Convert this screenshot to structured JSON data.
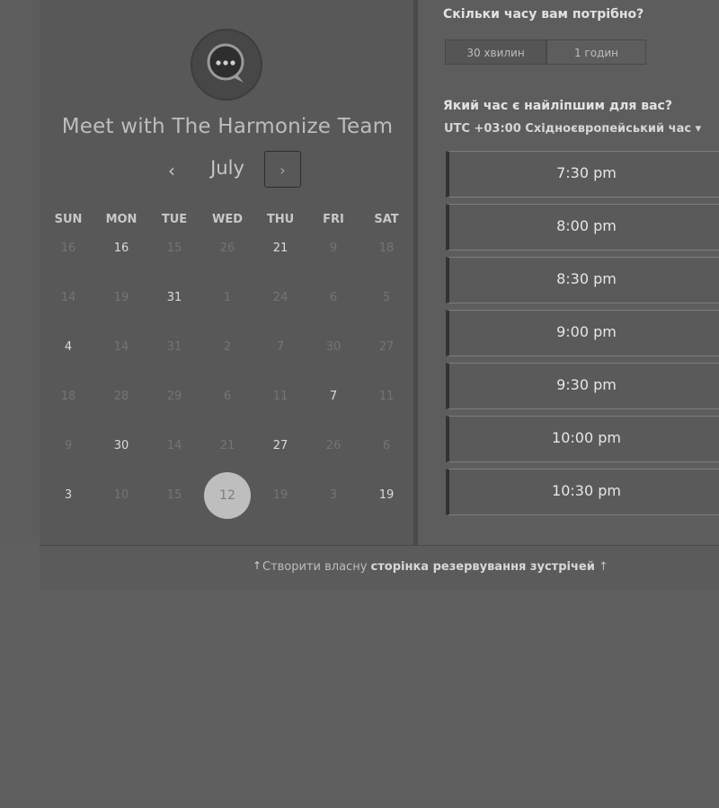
{
  "scheduler": {
    "title": "Meet with The Harmonize Team",
    "nav": {
      "prev_icon": "‹",
      "next_icon": "›",
      "month": "July"
    },
    "weekdays": [
      "SUN",
      "MON",
      "TUE",
      "WED",
      "THU",
      "FRI",
      "SAT"
    ],
    "weeks": [
      [
        {
          "d": "16",
          "s": "dim"
        },
        {
          "d": "16",
          "s": "on"
        },
        {
          "d": "15",
          "s": "dim"
        },
        {
          "d": "26",
          "s": "dim"
        },
        {
          "d": "21",
          "s": "on"
        },
        {
          "d": "9",
          "s": "dim"
        },
        {
          "d": "18",
          "s": "dim"
        }
      ],
      [
        {
          "d": "14",
          "s": "dim"
        },
        {
          "d": "19",
          "s": "dim"
        },
        {
          "d": "31",
          "s": "on"
        },
        {
          "d": "1",
          "s": "dim"
        },
        {
          "d": "24",
          "s": "dim"
        },
        {
          "d": "6",
          "s": "dim"
        },
        {
          "d": "5",
          "s": "dim"
        }
      ],
      [
        {
          "d": "4",
          "s": "on"
        },
        {
          "d": "14",
          "s": "dim"
        },
        {
          "d": "31",
          "s": "dim"
        },
        {
          "d": "2",
          "s": "dim"
        },
        {
          "d": "7",
          "s": "dim"
        },
        {
          "d": "30",
          "s": "dim"
        },
        {
          "d": "27",
          "s": "dim"
        }
      ],
      [
        {
          "d": "18",
          "s": "dim"
        },
        {
          "d": "28",
          "s": "dim"
        },
        {
          "d": "29",
          "s": "dim"
        },
        {
          "d": "6",
          "s": "dim"
        },
        {
          "d": "11",
          "s": "dim"
        },
        {
          "d": "7",
          "s": "on"
        },
        {
          "d": "11",
          "s": "dim"
        }
      ],
      [
        {
          "d": "9",
          "s": "dim"
        },
        {
          "d": "30",
          "s": "on"
        },
        {
          "d": "14",
          "s": "dim"
        },
        {
          "d": "21",
          "s": "dim"
        },
        {
          "d": "27",
          "s": "on"
        },
        {
          "d": "26",
          "s": "dim"
        },
        {
          "d": "6",
          "s": "dim"
        }
      ],
      [
        {
          "d": "3",
          "s": "on"
        },
        {
          "d": "10",
          "s": "dim"
        },
        {
          "d": "15",
          "s": "dim"
        },
        {
          "d": "12",
          "s": "sel"
        },
        {
          "d": "19",
          "s": "dim"
        },
        {
          "d": "3",
          "s": "dim"
        },
        {
          "d": "19",
          "s": "on"
        }
      ]
    ]
  },
  "duration": {
    "question": "Скільки часу вам потрібно?",
    "options": [
      "30 хвилин",
      "1 годин"
    ]
  },
  "time": {
    "question": "Який час є найліпшим для вас?",
    "timezone": "UTC +03:00 Східноєвропейський час",
    "timezone_icon": "▾",
    "slots": [
      "7:30 pm",
      "8:00 pm",
      "8:30 pm",
      "9:00 pm",
      "9:30 pm",
      "10:00 pm",
      "10:30 pm"
    ]
  },
  "footer": {
    "icon": "↑",
    "prefix": "Створити власну",
    "link": "сторінка резервування зустрічей",
    "suffix_icon": "↑"
  }
}
